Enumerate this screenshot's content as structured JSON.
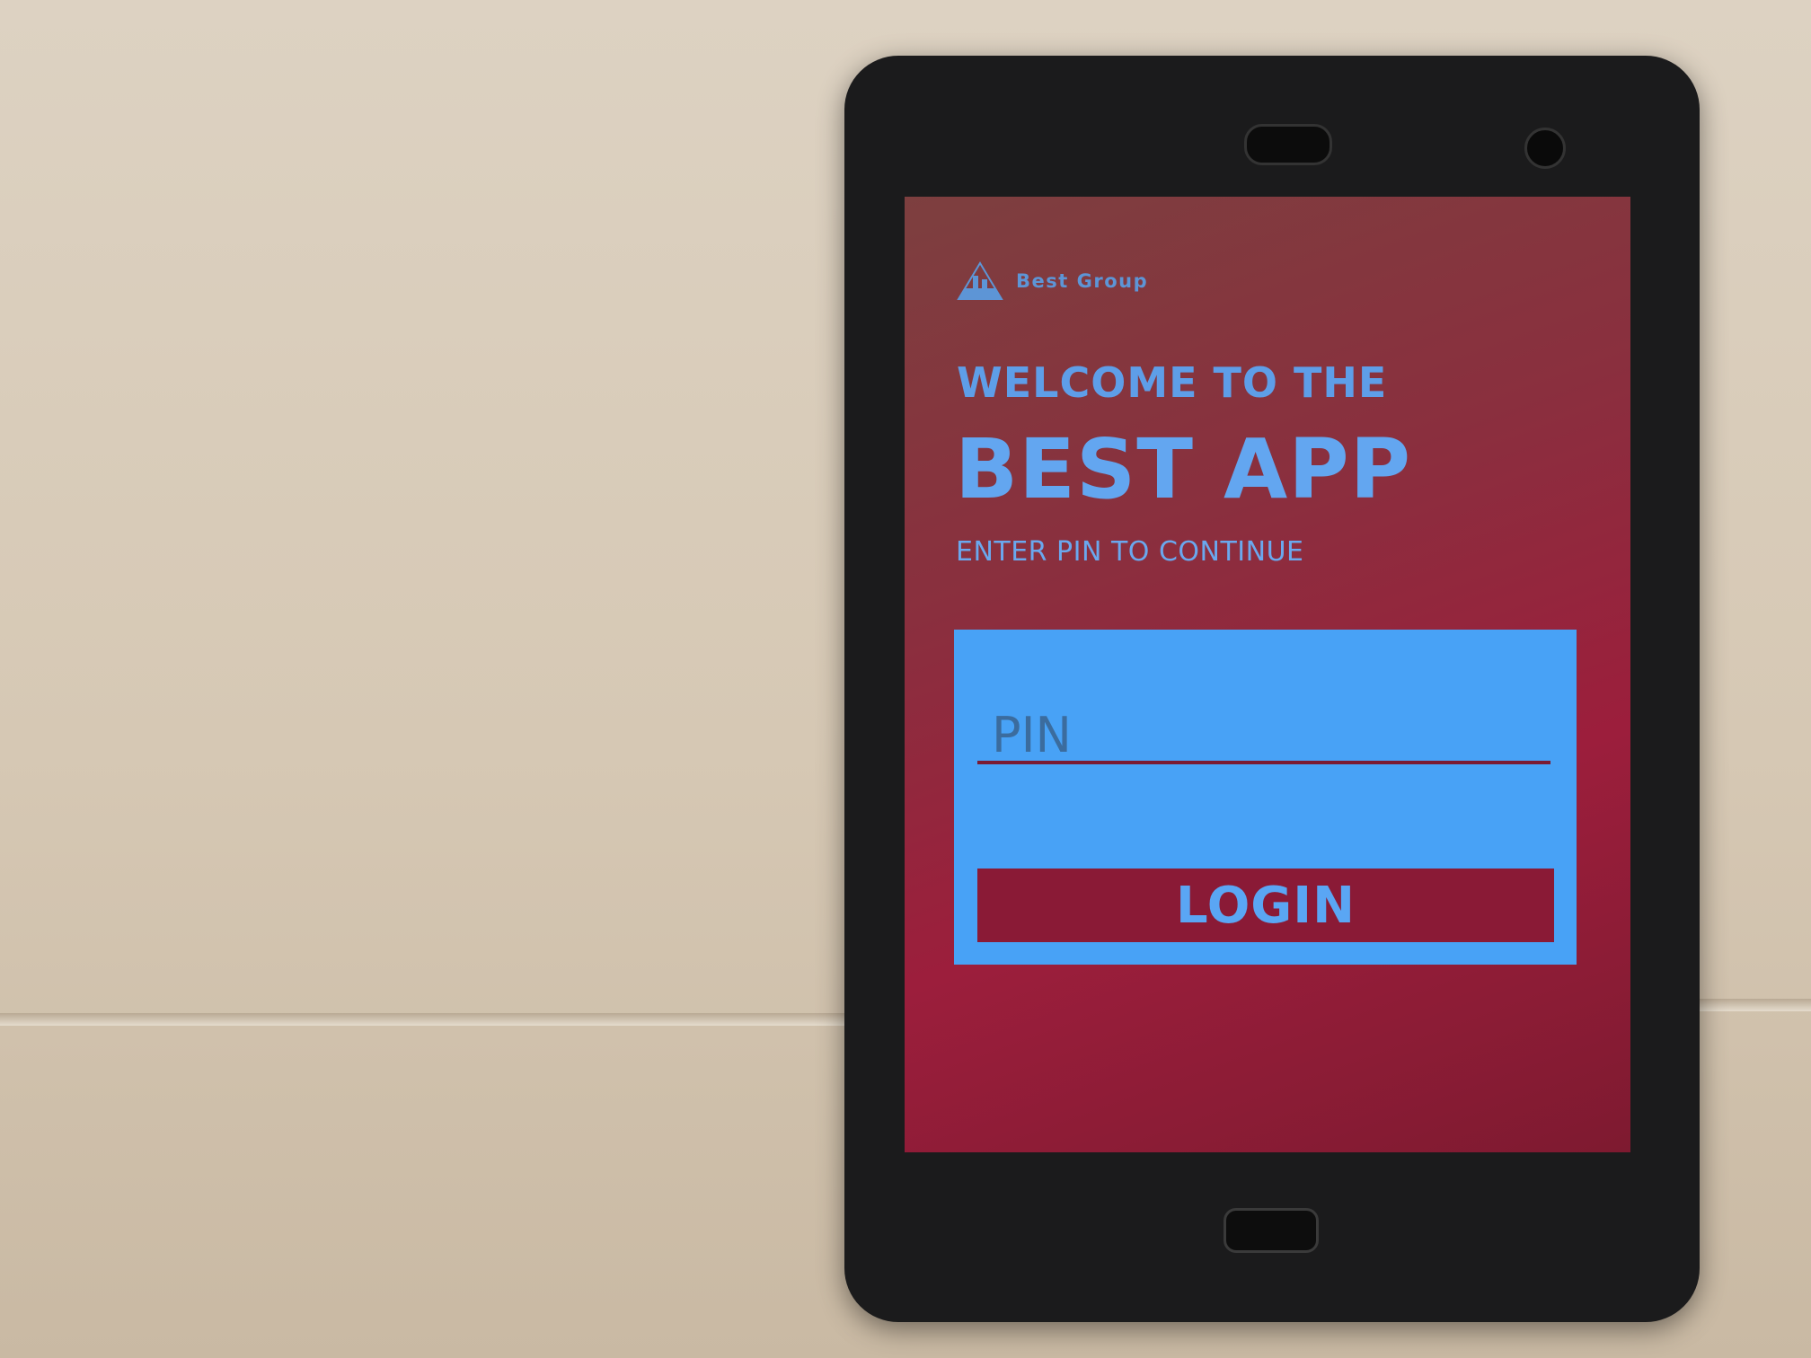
{
  "app": {
    "brand": "Best Group",
    "welcome_line": "WELCOME TO THE",
    "app_name": "BEST APP",
    "instruction": "ENTER PIN TO CONTINUE",
    "pin_field": {
      "placeholder": "PIN",
      "value": ""
    },
    "login_label": "LOGIN"
  },
  "colors": {
    "screen_bg": "#8a2f3e",
    "accent_blue": "#48a2f6",
    "button": "#8a1a36"
  },
  "icons": {
    "logo": "triangle-building-logo-icon"
  }
}
